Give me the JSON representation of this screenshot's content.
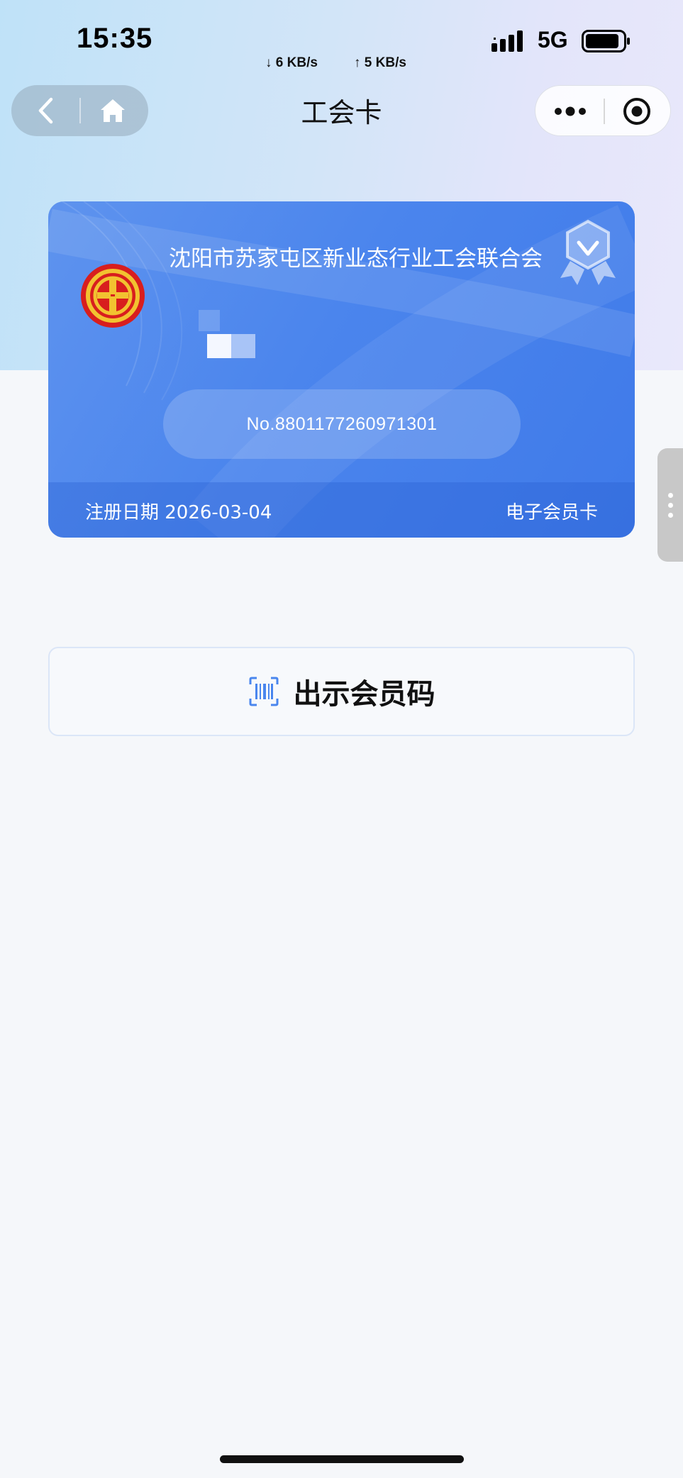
{
  "status_bar": {
    "time": "15:35",
    "download_speed": "↓ 6 KB/s",
    "upload_speed": "↑ 5 KB/s",
    "network": "5G",
    "battery_level": 0.8
  },
  "nav": {
    "title": "工会卡",
    "back_icon": "chevron-left-icon",
    "home_icon": "home-icon",
    "more_icon": "more-dots-icon",
    "close_icon": "target-close-icon"
  },
  "card": {
    "org_name": "沈阳市苏家屯区新业态行业工会联合会",
    "card_number": "No.8801177260971301",
    "registration_date_label": "注册日期 2026-03-04",
    "card_type": "电子会员卡",
    "colors": {
      "card_blue": "#4b85ed",
      "emblem_red": "#d81e1e",
      "emblem_gold": "#f2c230"
    }
  },
  "actions": {
    "show_code_label": "出示会员码",
    "show_code_icon": "barcode-scan-icon"
  }
}
